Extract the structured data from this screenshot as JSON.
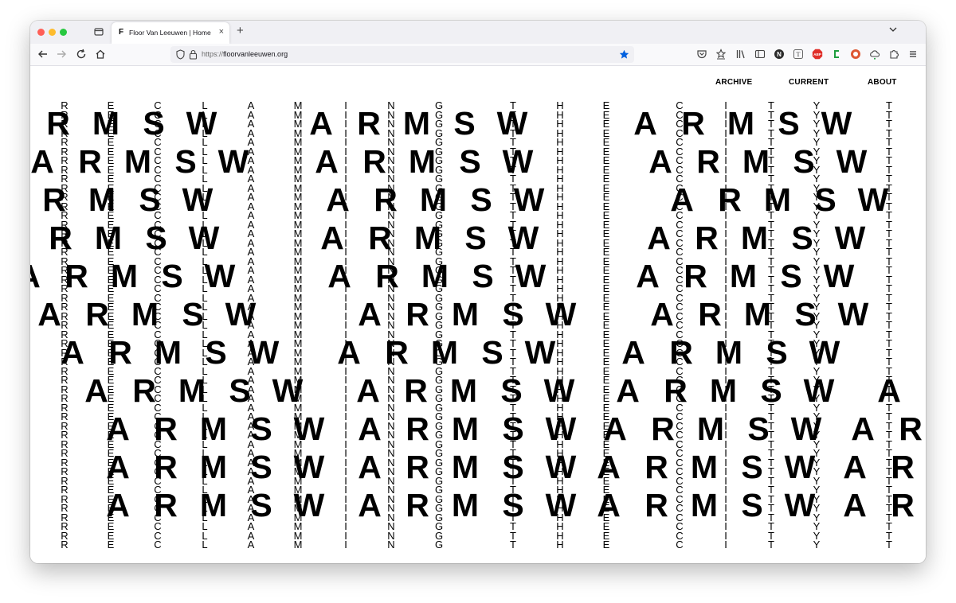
{
  "browser": {
    "tab_favicon": "F",
    "tab_title": "Floor Van Leeuwen | Home",
    "tab_close": "×",
    "new_tab": "+",
    "url_protocol": "https://",
    "url_host": "floorvanleeuwen.org",
    "accent_color": "#0060df"
  },
  "site": {
    "nav": [
      "ARCHIVE",
      "CURRENT",
      "ABOUT"
    ],
    "word": "SWARM",
    "column_letters": [
      "R",
      "E",
      "C",
      "L",
      "A",
      "M",
      "I",
      "N",
      "G",
      "T",
      "H",
      "E",
      "C",
      "I",
      "T",
      "Y",
      "T"
    ]
  }
}
